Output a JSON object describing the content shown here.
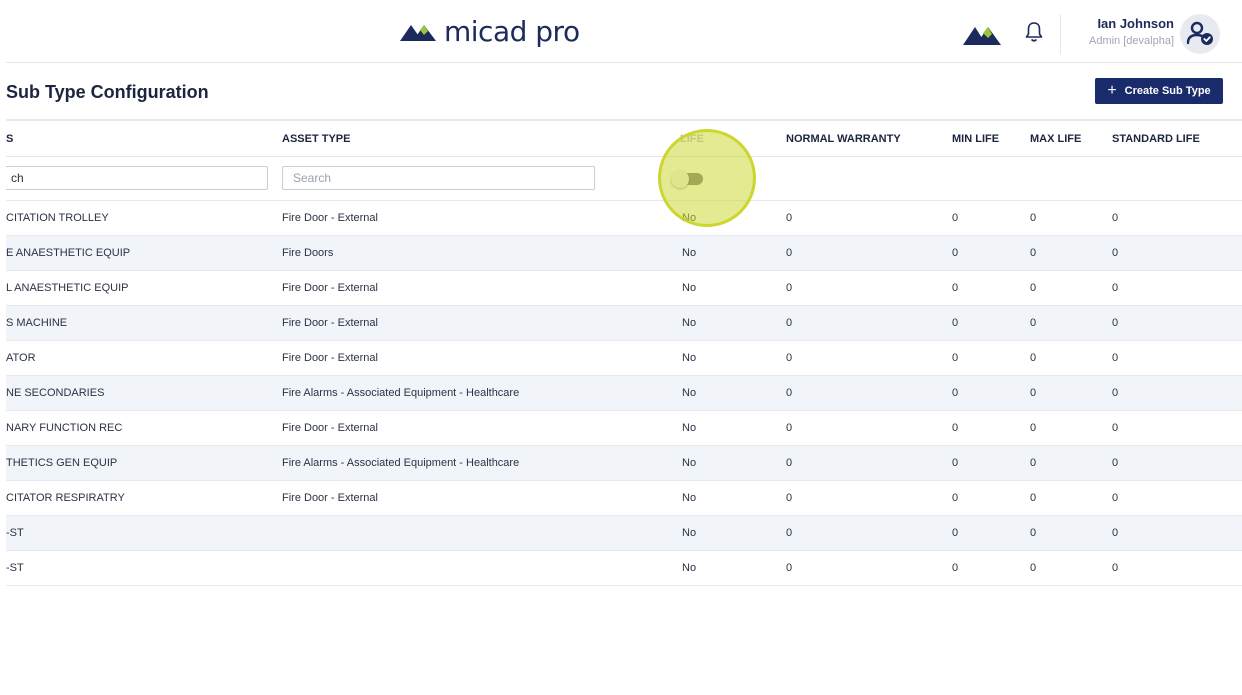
{
  "header": {
    "logo_text": "micad pro",
    "user_name": "Ian Johnson",
    "user_role": "Admin [devalpha]"
  },
  "page": {
    "title": "Sub Type Configuration",
    "create_button_label": "Create Sub Type",
    "create_button_icon": "+"
  },
  "table": {
    "columns": [
      "S",
      "ASSET TYPE",
      "LIFE",
      "NORMAL WARRANTY",
      "MIN LIFE",
      "MAX LIFE",
      "STANDARD LIFE"
    ],
    "filters": {
      "col1_value": "ch",
      "asset_type_placeholder": "Search",
      "life_toggle_on": false
    },
    "rows": [
      {
        "name": "CITATION TROLLEY",
        "asset_type": "Fire Door - External",
        "life": "No",
        "normal_warranty": "0",
        "min_life": "0",
        "max_life": "0",
        "standard_life": "0"
      },
      {
        "name": "E ANAESTHETIC EQUIP",
        "asset_type": "Fire Doors",
        "life": "No",
        "normal_warranty": "0",
        "min_life": "0",
        "max_life": "0",
        "standard_life": "0"
      },
      {
        "name": "L ANAESTHETIC EQUIP",
        "asset_type": "Fire Door - External",
        "life": "No",
        "normal_warranty": "0",
        "min_life": "0",
        "max_life": "0",
        "standard_life": "0"
      },
      {
        "name": "S MACHINE",
        "asset_type": "Fire Door - External",
        "life": "No",
        "normal_warranty": "0",
        "min_life": "0",
        "max_life": "0",
        "standard_life": "0"
      },
      {
        "name": "ATOR",
        "asset_type": "Fire Door - External",
        "life": "No",
        "normal_warranty": "0",
        "min_life": "0",
        "max_life": "0",
        "standard_life": "0"
      },
      {
        "name": "NE SECONDARIES",
        "asset_type": "Fire Alarms - Associated Equipment - Healthcare",
        "life": "No",
        "normal_warranty": "0",
        "min_life": "0",
        "max_life": "0",
        "standard_life": "0"
      },
      {
        "name": "NARY FUNCTION REC",
        "asset_type": "Fire Door - External",
        "life": "No",
        "normal_warranty": "0",
        "min_life": "0",
        "max_life": "0",
        "standard_life": "0"
      },
      {
        "name": "THETICS GEN EQUIP",
        "asset_type": "Fire Alarms - Associated Equipment - Healthcare",
        "life": "No",
        "normal_warranty": "0",
        "min_life": "0",
        "max_life": "0",
        "standard_life": "0"
      },
      {
        "name": "CITATOR RESPIRATRY",
        "asset_type": "Fire Door - External",
        "life": "No",
        "normal_warranty": "0",
        "min_life": "0",
        "max_life": "0",
        "standard_life": "0"
      },
      {
        "name": "-ST",
        "asset_type": "",
        "life": "No",
        "normal_warranty": "0",
        "min_life": "0",
        "max_life": "0",
        "standard_life": "0"
      },
      {
        "name": "-ST",
        "asset_type": "",
        "life": "No",
        "normal_warranty": "0",
        "min_life": "0",
        "max_life": "0",
        "standard_life": "0"
      }
    ]
  },
  "colors": {
    "brand_navy": "#1a2b6b",
    "brand_green": "#9bc33c",
    "row_alt": "#f1f4f9",
    "highlight": "#ced937"
  },
  "icons": {
    "logo": "micad-mountain-logo",
    "brand_mark": "micad-mountain-mark",
    "notifications": "bell-icon",
    "avatar": "user-check-icon"
  }
}
